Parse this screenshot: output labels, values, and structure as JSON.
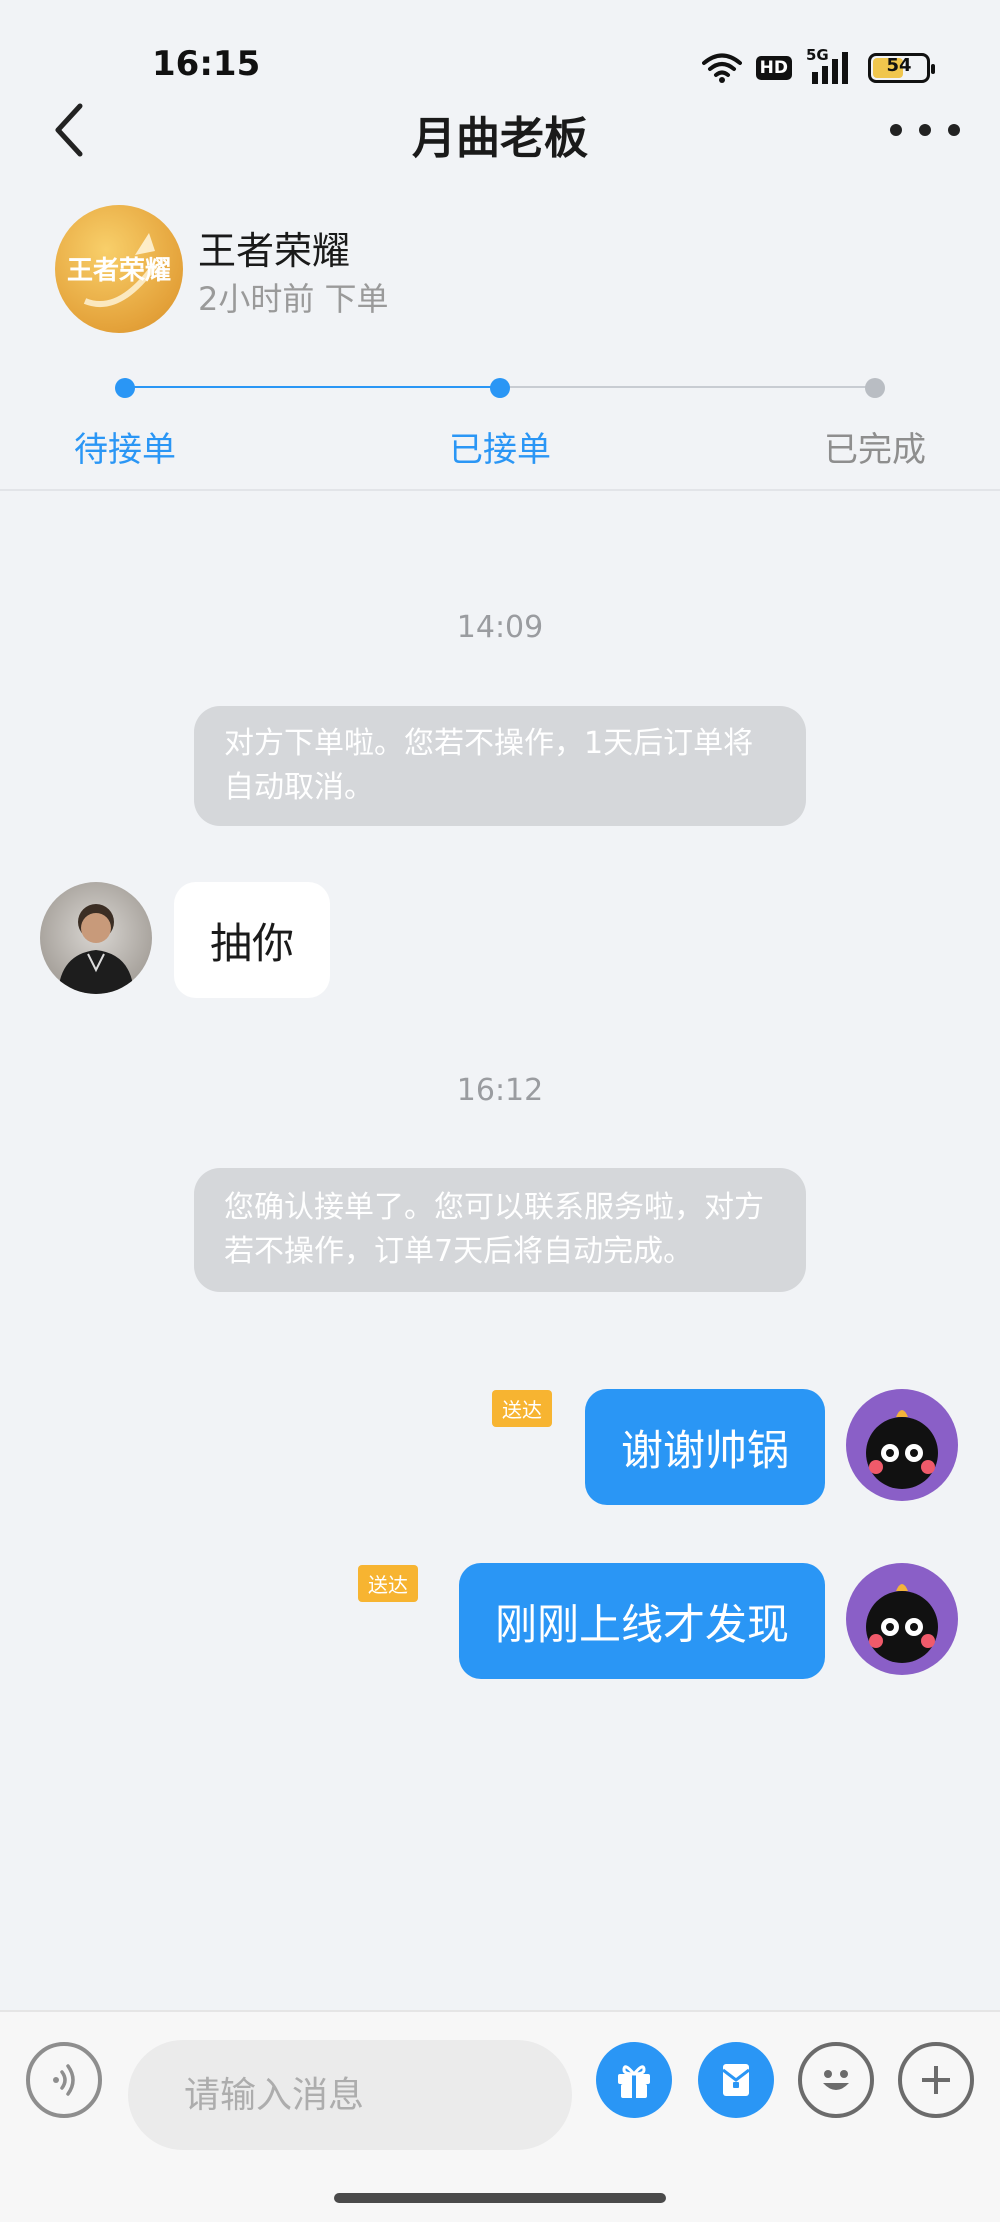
{
  "status_bar": {
    "time": "16:15",
    "hd": "HD",
    "network": "5G",
    "battery": "54",
    "battery_level": 0.54
  },
  "nav": {
    "title": "月曲老板"
  },
  "order": {
    "game_name": "王者荣耀",
    "logo_text": "王者荣耀",
    "time_ago": "2小时前 下单"
  },
  "progress": {
    "steps": [
      {
        "label": "待接单",
        "status": "done"
      },
      {
        "label": "已接单",
        "status": "current"
      },
      {
        "label": "已完成",
        "status": "pending"
      }
    ],
    "colors": {
      "active": "#2a96f5",
      "inactive": "#b9bdc3",
      "inactive_text": "#8e8e8e"
    }
  },
  "messages": {
    "timestamp_1": "14:09",
    "system_1": "对方下单啦。您若不操作，1天后订单将自动取消。",
    "incoming_1": "抽你",
    "timestamp_2": "16:12",
    "system_2": "您确认接单了。您可以联系服务啦，对方若不操作，订单7天后将自动完成。",
    "outgoing_1": "谢谢帅锅",
    "outgoing_1_status": "送达",
    "outgoing_2": "刚刚上线才发现",
    "outgoing_2_status": "送达"
  },
  "input": {
    "placeholder": "请输入消息"
  },
  "icons": {
    "back": "chevron-left-icon",
    "more": "more-horizontal-icon",
    "voice": "voice-icon",
    "gift": "gift-icon",
    "red_packet": "red-packet-icon",
    "emoji": "emoji-icon",
    "plus": "plus-icon"
  }
}
